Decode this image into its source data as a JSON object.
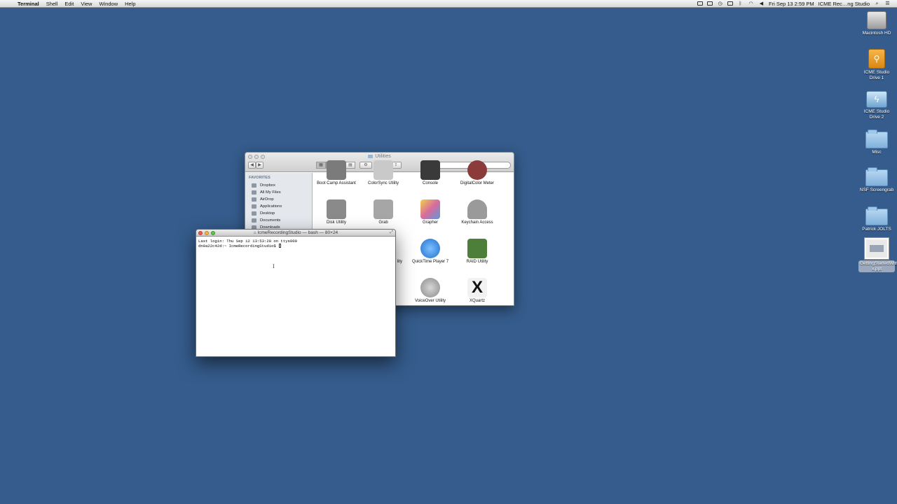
{
  "menubar": {
    "app_name": "Terminal",
    "menus": [
      "Shell",
      "Edit",
      "View",
      "Window",
      "Help"
    ],
    "clock": "Fri Sep 13  2:59 PM",
    "user": "ICME Rec…ng Studio",
    "status_icons": [
      "dropbox-icon",
      "display-icon",
      "time-machine-icon",
      "timer-icon",
      "bluetooth-icon",
      "wifi-icon",
      "volume-icon",
      "search-icon",
      "notification-center-icon"
    ]
  },
  "desktop": {
    "icons": [
      {
        "label": "Macintosh HD",
        "type": "hard-drive-icon"
      },
      {
        "label": "ICME Studio Drive 1",
        "type": "usb-drive-icon"
      },
      {
        "label": "ICME Studio Drive 2",
        "type": "thunderbolt-drive-icon"
      },
      {
        "label": "Misc",
        "type": "folder-icon"
      },
      {
        "label": "NSF Screengrab",
        "type": "folder-icon"
      },
      {
        "label": "Patrick JOLTS",
        "type": "folder-icon"
      },
      {
        "label": "GettingStartedWith…x.ppt",
        "type": "ppt-file-icon"
      }
    ]
  },
  "finder": {
    "title": "Utilities",
    "search_placeholder": "",
    "sidebar_heading": "FAVORITES",
    "sidebar_items": [
      "Dropbox",
      "All My Files",
      "AirDrop",
      "Applications",
      "Desktop",
      "Documents",
      "Downloads"
    ],
    "apps": [
      {
        "name": "Boot Camp Assistant",
        "color": "#7b7b7b"
      },
      {
        "name": "ColorSync Utility",
        "color": "#c9c9c9"
      },
      {
        "name": "Console",
        "color": "#3a3a3a"
      },
      {
        "name": "DigitalColor Meter",
        "color": "#8c3b3b"
      },
      {
        "name": "Disk Utility",
        "color": "#8a8a8a"
      },
      {
        "name": "Grab",
        "color": "#a6a6a6"
      },
      {
        "name": "Grapher",
        "color": "#d86b9e"
      },
      {
        "name": "Keychain Access",
        "color": "#9a9a9a"
      },
      {
        "name": "QuickTime Player 7",
        "color": "#2f7fd6"
      },
      {
        "name": "RAID Utility",
        "color": "#4d7f3b"
      },
      {
        "name": "VoiceOver Utility",
        "color": "#9d9d9d"
      },
      {
        "name": "XQuartz",
        "color": "#f2f2f2"
      }
    ],
    "partial_label": "lity"
  },
  "terminal": {
    "title": "IcmeRecordingStudio — bash — 80×24",
    "line1": "Last login: Thu Sep 12 13:53:28 on ttys000",
    "prompt": "dn0a22c42d:~ IcmeRecordingStudio$ "
  }
}
